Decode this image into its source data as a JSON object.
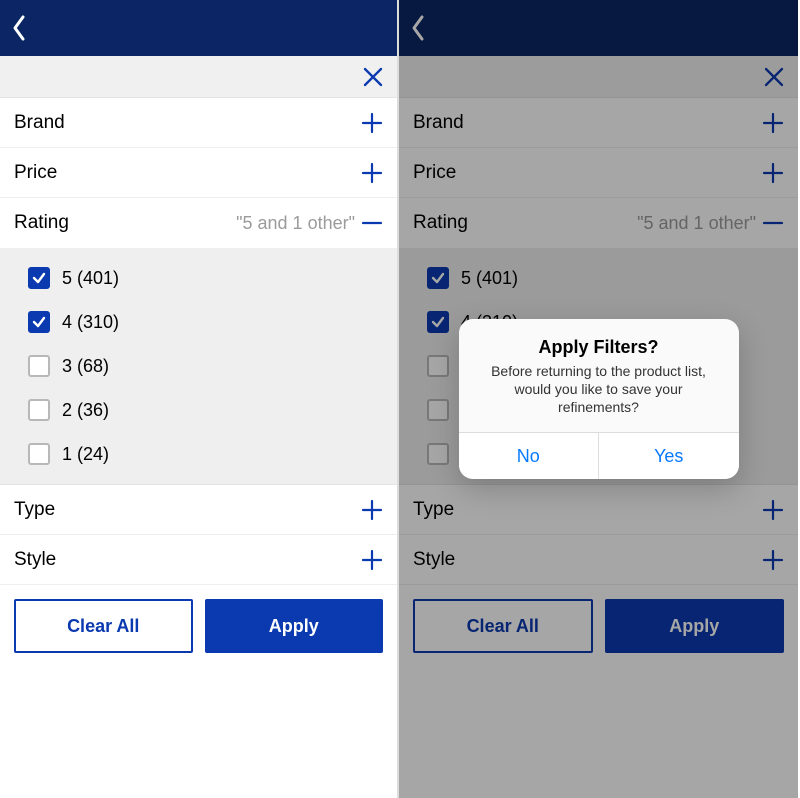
{
  "header": {},
  "closebar": {},
  "filters": {
    "brand": {
      "label": "Brand"
    },
    "price": {
      "label": "Price"
    },
    "rating": {
      "label": "Rating",
      "summary": "\"5 and 1 other\""
    },
    "type": {
      "label": "Type"
    },
    "style": {
      "label": "Style"
    }
  },
  "rating_options": [
    {
      "label": "5  (401)",
      "checked": true
    },
    {
      "label": "4  (310)",
      "checked": true
    },
    {
      "label": "3  (68)",
      "checked": false
    },
    {
      "label": "2  (36)",
      "checked": false
    },
    {
      "label": "1  (24)",
      "checked": false
    }
  ],
  "actions": {
    "clear": "Clear All",
    "apply": "Apply"
  },
  "dialog": {
    "title": "Apply Filters?",
    "message": "Before returning to the product list, would you like to save your refinements?",
    "no": "No",
    "yes": "Yes"
  }
}
